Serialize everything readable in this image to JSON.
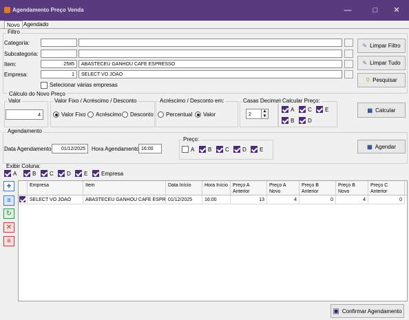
{
  "window": {
    "title": "Agendamento Preço Venda"
  },
  "tabs": [
    "Novo",
    "Agendado"
  ],
  "filtro": {
    "title": "Filtro",
    "categoria_label": "Categoria:",
    "categoria_code": "",
    "categoria_desc": "",
    "subcategoria_label": "Subcategoria:",
    "subcategoria_code": "",
    "subcategoria_desc": "",
    "item_label": "Item:",
    "item_code": "2585",
    "item_desc": "ABASTECEU GANHOU CAFE ESPRESSO",
    "empresa_label": "Empresa:",
    "empresa_code": "1",
    "empresa_desc": "SELECT VO JOAO",
    "selecionar_label": "Selecionar várias empresas",
    "limpar_filtro": "Limpar Filtro",
    "limpar_tudo": "Limpar Tudo",
    "pesquisar": "Pesquisar"
  },
  "calculo": {
    "title": "Cálculo do Novo Preço",
    "valor_title": "Valor",
    "valor": "4",
    "modo_title": "Valor Fixo / Acréscimo / Desconto",
    "modo_options": [
      "Valor Fixo",
      "Acréscimo",
      "Desconto"
    ],
    "modo_selected": "Valor Fixo",
    "em_title": "Acréscimo / Desconto em:",
    "em_options": [
      "Percentual",
      "Valor"
    ],
    "em_selected": "Valor",
    "casas_title": "Casas Decimais",
    "casas_value": "2",
    "calcular_preco_title": "Calcular Preço:",
    "calcular_preco": [
      {
        "label": "A",
        "checked": true
      },
      {
        "label": "C",
        "checked": true
      },
      {
        "label": "E",
        "checked": true
      },
      {
        "label": "B",
        "checked": true
      },
      {
        "label": "D",
        "checked": true
      }
    ],
    "calcular_btn": "Calcular"
  },
  "agendamento": {
    "title": "Agendamento",
    "data_label": "Data Agendamento:",
    "data_value": "01/12/2025",
    "hora_label": "Hora Agendamento:",
    "hora_value": "16:00",
    "preco_title": "Preço:",
    "preco": [
      {
        "label": "A",
        "checked": false
      },
      {
        "label": "B",
        "checked": true
      },
      {
        "label": "C",
        "checked": true
      },
      {
        "label": "D",
        "checked": true
      },
      {
        "label": "E",
        "checked": true
      }
    ],
    "agendar_btn": "Agendar"
  },
  "exibir": {
    "title": "Exibir Coluna:",
    "cols": [
      {
        "label": "A",
        "checked": true
      },
      {
        "label": "B",
        "checked": true
      },
      {
        "label": "C",
        "checked": true
      },
      {
        "label": "D",
        "checked": true
      },
      {
        "label": "E",
        "checked": true
      },
      {
        "label": "Empresa",
        "checked": true
      }
    ]
  },
  "grid": {
    "headers": [
      "Empresa",
      "Item",
      "Data Início",
      "Hora Início",
      "Preço A Anterior",
      "Preço A Novo",
      "Preço B Anterior",
      "Preço B Novo",
      "Preço C Anterior"
    ],
    "rows": [
      {
        "checked": true,
        "cells": [
          "SELECT VO JOAO",
          "ABASTECEU GANHOU CAFE ESPRESSO",
          "01/12/2025",
          "16:00",
          "13",
          "4",
          "0",
          "4",
          "0"
        ]
      }
    ]
  },
  "confirmar_btn": "Confirmar Agendamento",
  "colors": {
    "title_bg": "#5a3a7e",
    "check": "#4b2a7a"
  }
}
